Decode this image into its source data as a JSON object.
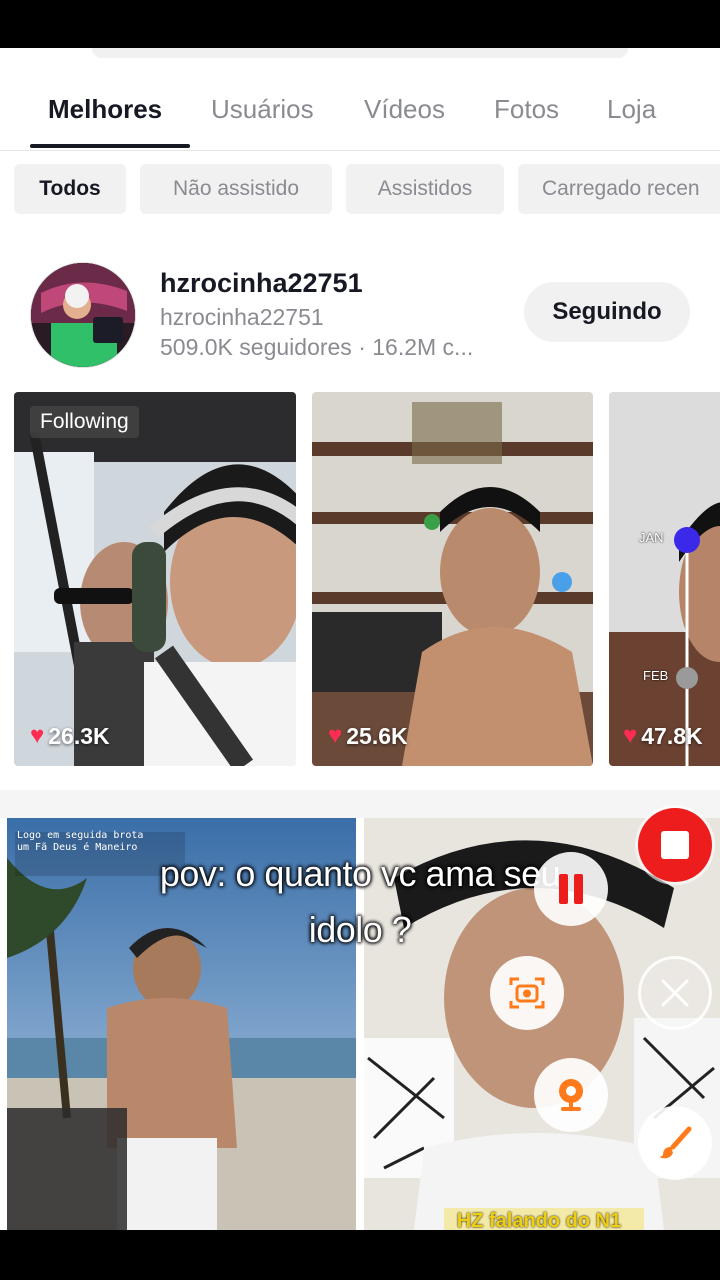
{
  "tabs": [
    {
      "label": "Melhores",
      "active": true
    },
    {
      "label": "Usuários"
    },
    {
      "label": "Vídeos"
    },
    {
      "label": "Fotos"
    },
    {
      "label": "Loja"
    }
  ],
  "filters": [
    {
      "label": "Todos",
      "active": true
    },
    {
      "label": "Não assistido"
    },
    {
      "label": "Assistidos"
    },
    {
      "label": "Carregado recen"
    }
  ],
  "user": {
    "username": "hzrocinha22751",
    "handle": "hzrocinha22751",
    "stats": "509.0K seguidores · 16.2M c...",
    "follow_label": "Seguindo"
  },
  "videos": [
    {
      "likes": "26.3K",
      "badge": "Following"
    },
    {
      "likes": "25.6K"
    },
    {
      "likes": "47.8K",
      "slider_top": "JAN",
      "slider_bottom": "FEB"
    }
  ],
  "bottom_videos": [
    {
      "inset_text": "Logo em seguida brota um Fã Deus é Maneiro"
    },
    {
      "caption": "HZ falando do N1"
    }
  ],
  "overlay": {
    "caption_line1": "pov: o quanto vc ama seu",
    "caption_line2": "idolo ?"
  },
  "colors": {
    "accent": "#fe2c55",
    "record": "#ee1d1d",
    "recorder_orange": "#ff7a1a"
  }
}
